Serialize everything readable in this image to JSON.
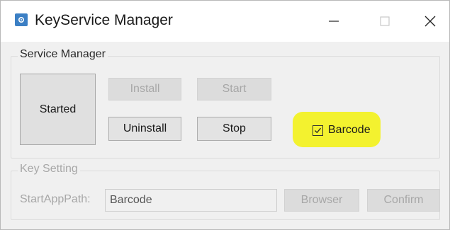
{
  "window": {
    "title": "KeyService Manager",
    "icon": "gear-icon",
    "controls": [
      "minimize-icon",
      "maximize-icon",
      "close-icon"
    ]
  },
  "service_manager": {
    "label": "Service Manager",
    "status_label": "Started",
    "install_label": "Install",
    "start_label": "Start",
    "uninstall_label": "Uninstall",
    "stop_label": "Stop",
    "barcode_checkbox": {
      "label": "Barcode",
      "checked": true
    },
    "highlight_color": "#f3f22f"
  },
  "key_setting": {
    "label": "Key Setting",
    "path_label": "StartAppPath:",
    "path_value": "Barcode",
    "browser_label": "Browser",
    "confirm_label": "Confirm"
  }
}
